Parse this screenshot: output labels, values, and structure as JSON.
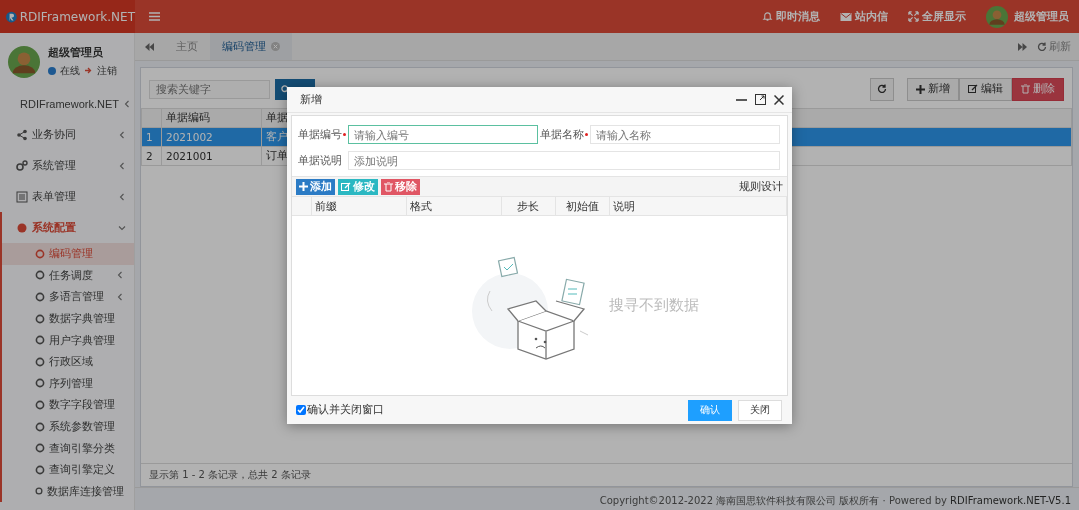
{
  "header": {
    "logo_text": "RDIFramework.NET",
    "actions": [
      {
        "label": "即时消息",
        "kind": "bell"
      },
      {
        "label": "站内信",
        "kind": "mail"
      },
      {
        "label": "全屏显示",
        "kind": "expand"
      }
    ],
    "user_name": "超级管理员"
  },
  "sidebar": {
    "user": {
      "name": "超级管理员",
      "status": "在线",
      "logout": "注销"
    },
    "menu": [
      {
        "label": "RDIFramework.NET",
        "expanded": false,
        "selected": false
      },
      {
        "label": "业务协同",
        "expanded": false,
        "selected": false
      },
      {
        "label": "系统管理",
        "expanded": false,
        "selected": false
      },
      {
        "label": "表单管理",
        "expanded": false,
        "selected": false
      },
      {
        "label": "系统配置",
        "expanded": true,
        "selected": true,
        "children": [
          {
            "label": "编码管理",
            "selected": true
          },
          {
            "label": "任务调度",
            "expanded": false,
            "selected": false
          },
          {
            "label": "多语言管理",
            "expanded": false,
            "selected": false
          },
          {
            "label": "数据字典管理",
            "selected": false
          },
          {
            "label": "用户字典管理",
            "selected": false
          },
          {
            "label": "行政区域",
            "selected": false
          },
          {
            "label": "序列管理",
            "selected": false
          },
          {
            "label": "数字字段管理",
            "selected": false
          },
          {
            "label": "系统参数管理",
            "selected": false
          },
          {
            "label": "查询引擎分类",
            "selected": false
          },
          {
            "label": "查询引擎定义",
            "selected": false
          },
          {
            "label": "数据库连接管理",
            "selected": false
          }
        ]
      }
    ]
  },
  "tabs": [
    {
      "label": "主页",
      "selected": false
    },
    {
      "label": "编码管理",
      "selected": true
    }
  ],
  "refresh_label": "刷新",
  "main": {
    "search": {
      "placeholder": "搜索关键字"
    },
    "toolbar": [
      {
        "label": "新增",
        "kind": "add"
      },
      {
        "label": "编辑",
        "kind": "edit"
      },
      {
        "label": "删除",
        "kind": "delete"
      }
    ],
    "table": {
      "columns": [
        "",
        "单据编码",
        "单据"
      ],
      "rows": [
        {
          "cells": [
            "1",
            "2021002",
            "客户"
          ],
          "selected": true
        },
        {
          "cells": [
            "2",
            "2021001",
            "订单"
          ],
          "selected": false
        }
      ]
    },
    "status": "显示第 1 - 2 条记录，总共 2 条记录"
  },
  "footer": {
    "copyright": "Copyright©2012-2022 海南国思软件科技有限公司 版权所有 · Powered by",
    "link": "RDIFramework.NET-V5.1"
  },
  "dialog": {
    "title": "新增",
    "fields": [
      {
        "label": "单据编号",
        "required": true,
        "placeholder": "请输入编号",
        "focused": true,
        "kind": "half"
      },
      {
        "label": "单据名称",
        "required": true,
        "placeholder": "请输入名称",
        "focused": false,
        "kind": "half"
      },
      {
        "label": "单据说明",
        "required": false,
        "placeholder": "添加说明",
        "focused": false,
        "kind": "full"
      }
    ],
    "toolbar": [
      {
        "label": "添加",
        "kind": "add"
      },
      {
        "label": "修改",
        "kind": "edit"
      },
      {
        "label": "移除",
        "kind": "remove"
      }
    ],
    "rule_link": "规则设计",
    "columns": [
      "前缀",
      "格式",
      "步长",
      "初始值",
      "说明"
    ],
    "empty_text": "搜寻不到数据",
    "close_after_confirm": {
      "label": "确认并关闭窗口",
      "checked": true
    },
    "buttons": [
      {
        "label": "确认",
        "kind": "primary"
      },
      {
        "label": "关闭",
        "kind": "default"
      }
    ]
  }
}
